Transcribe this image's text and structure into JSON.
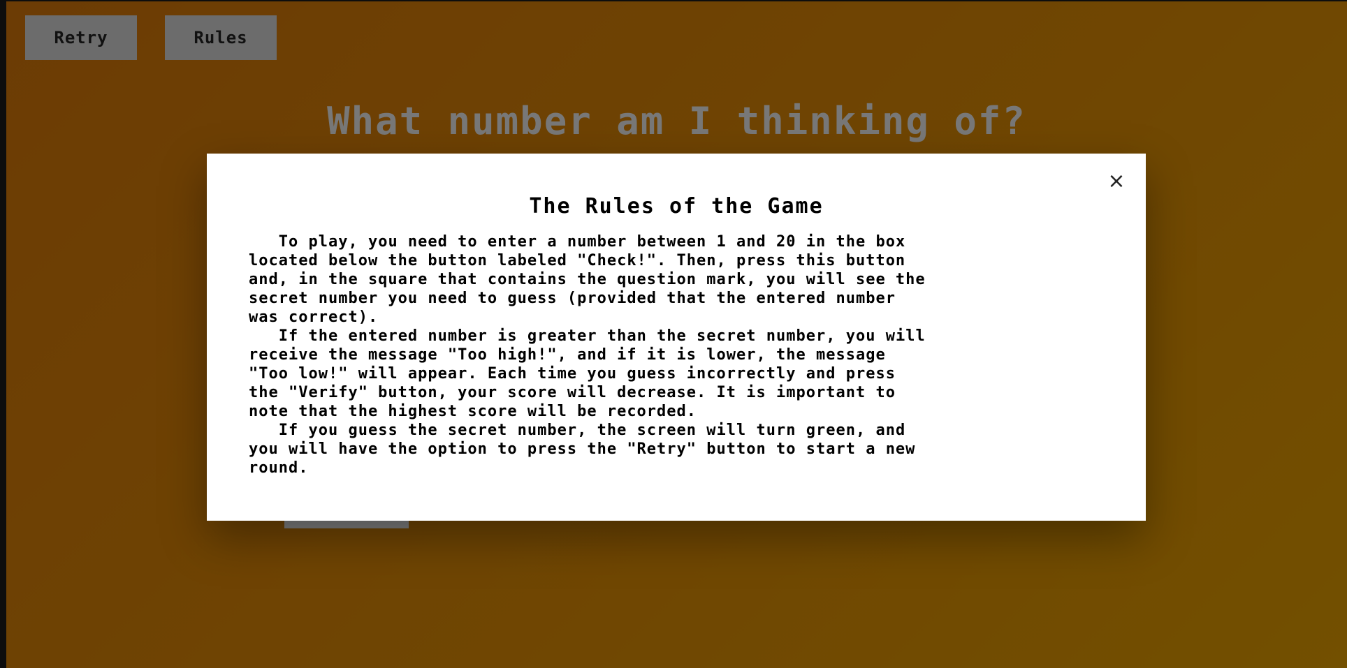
{
  "toolbar": {
    "retry_label": "Retry",
    "rules_label": "Rules"
  },
  "main": {
    "heading": "What number am I thinking of?"
  },
  "modal": {
    "close_glyph": "×",
    "title": "The Rules of the Game",
    "rules_text": "   To play, you need to enter a number between 1 and 20 in the box\nlocated below the button labeled \"Check!\". Then, press this button\nand, in the square that contains the question mark, you will see the\nsecret number you need to guess (provided that the entered number\nwas correct).\n   If the entered number is greater than the secret number, you will\nreceive the message \"Too high!\", and if it is lower, the message\n\"Too low!\" will appear. Each time you guess incorrectly and press\nthe \"Verify\" button, your score will decrease. It is important to\nnote that the highest score will be recorded.\n   If you guess the secret number, the screen will turn green, and\nyou will have the option to press the \"Retry\" button to start a new\nround."
  },
  "colors": {
    "background_start": "#d9780a",
    "background_end": "#e6a000",
    "button_bg": "#d8d8d8",
    "modal_bg": "#ffffff"
  },
  "icons": {
    "close": "close-icon"
  }
}
